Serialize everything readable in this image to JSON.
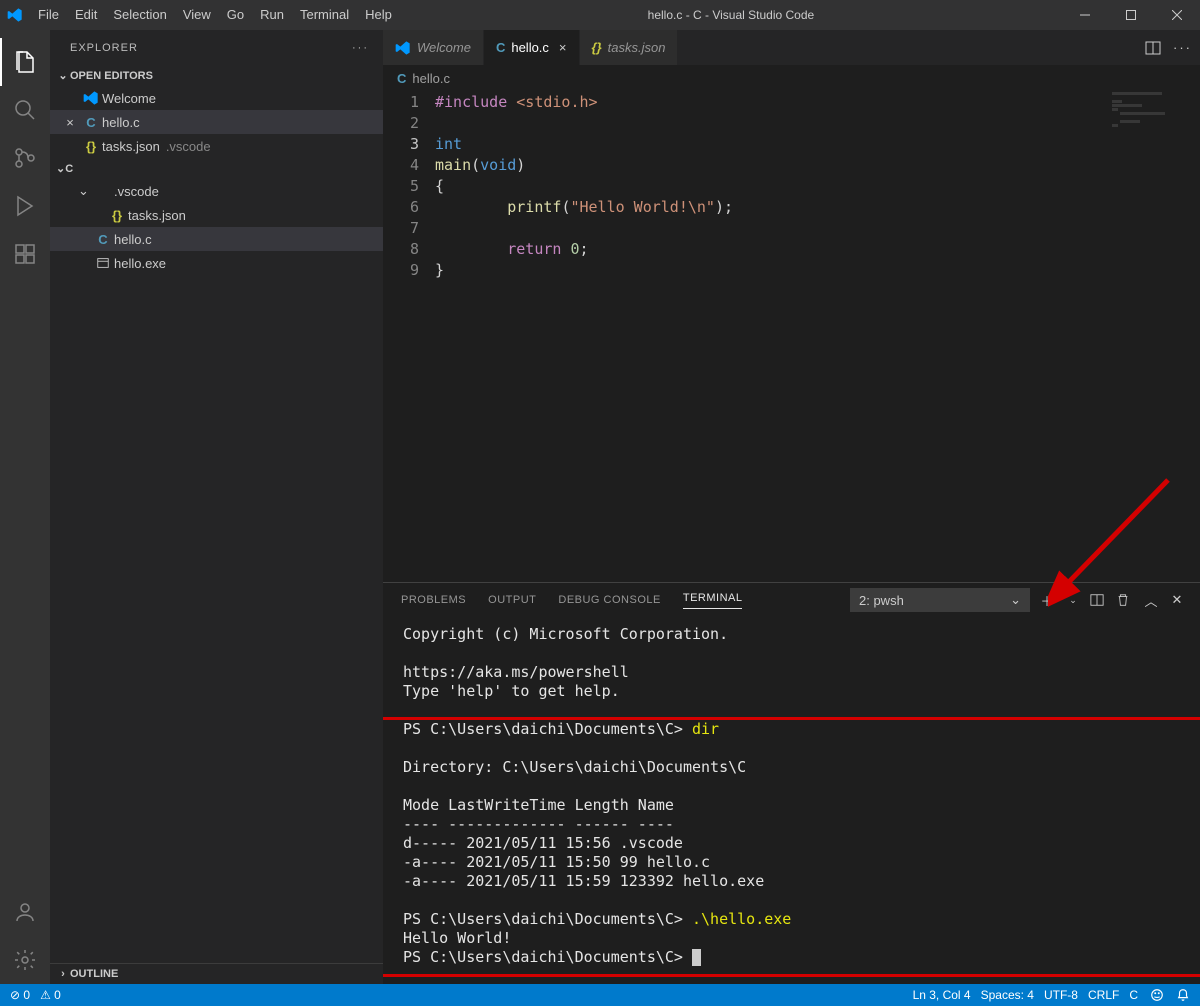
{
  "title": "hello.c - C - Visual Studio Code",
  "menu": [
    "File",
    "Edit",
    "Selection",
    "View",
    "Go",
    "Run",
    "Terminal",
    "Help"
  ],
  "sidebar": {
    "title": "EXPLORER",
    "openEditors": {
      "label": "OPEN EDITORS",
      "items": [
        {
          "name": "Welcome",
          "icon": "vscode"
        },
        {
          "name": "hello.c",
          "icon": "c",
          "active": true
        },
        {
          "name": "tasks.json",
          "icon": "json",
          "suffix": ".vscode"
        }
      ]
    },
    "folder": {
      "name": "C",
      "children": [
        {
          "name": ".vscode",
          "kind": "folder",
          "children": [
            {
              "name": "tasks.json",
              "icon": "json"
            }
          ]
        },
        {
          "name": "hello.c",
          "icon": "c",
          "active": true
        },
        {
          "name": "hello.exe",
          "icon": "exe"
        }
      ]
    },
    "outline": "OUTLINE"
  },
  "tabs": [
    {
      "label": "Welcome",
      "icon": "vscode"
    },
    {
      "label": "hello.c",
      "icon": "c",
      "active": true,
      "closeable": true
    },
    {
      "label": "tasks.json",
      "icon": "json"
    }
  ],
  "breadcrumb": {
    "icon": "c",
    "label": "hello.c"
  },
  "code": {
    "lines": [
      {
        "n": 1,
        "html": "<span class='kwinc'>#include</span> <span class='str'>&lt;stdio.h&gt;</span>"
      },
      {
        "n": 2,
        "html": ""
      },
      {
        "n": 3,
        "html": "<span class='kw'>int</span>",
        "current": true
      },
      {
        "n": 4,
        "html": "<span class='fn'>main</span>(<span class='tok-void'>void</span>)"
      },
      {
        "n": 5,
        "html": "{"
      },
      {
        "n": 6,
        "html": "        <span class='fn'>printf</span>(<span class='str'>\"Hello World!\\n\"</span>);"
      },
      {
        "n": 7,
        "html": ""
      },
      {
        "n": 8,
        "html": "        <span class='kwinc'>return</span> <span class='num'>0</span>;"
      },
      {
        "n": 9,
        "html": "}"
      }
    ]
  },
  "panel": {
    "tabs": [
      "PROBLEMS",
      "OUTPUT",
      "DEBUG CONSOLE",
      "TERMINAL"
    ],
    "activeTab": "TERMINAL",
    "termSelector": "2: pwsh",
    "terminal_lines": [
      "Copyright (c) Microsoft Corporation.",
      "",
      "https://aka.ms/powershell",
      "Type 'help' to get help.",
      "",
      "PS C:\\Users\\daichi\\Documents\\C> |dir",
      "",
      "    Directory: C:\\Users\\daichi\\Documents\\C",
      "",
      "Mode                 LastWriteTime         Length Name",
      "----                 -------------         ------ ----",
      "d-----        2021/05/11     15:56                .vscode",
      "-a----        2021/05/11     15:50             99 hello.c",
      "-a----        2021/05/11     15:59         123392 hello.exe",
      "",
      "PS C:\\Users\\daichi\\Documents\\C> |.\\hello.exe",
      "Hello World!",
      "PS C:\\Users\\daichi\\Documents\\C> "
    ]
  },
  "status": {
    "left": [
      "⊘ 0",
      "⚠ 0"
    ],
    "right": [
      "Ln 3, Col 4",
      "Spaces: 4",
      "UTF-8",
      "CRLF",
      "C"
    ]
  }
}
